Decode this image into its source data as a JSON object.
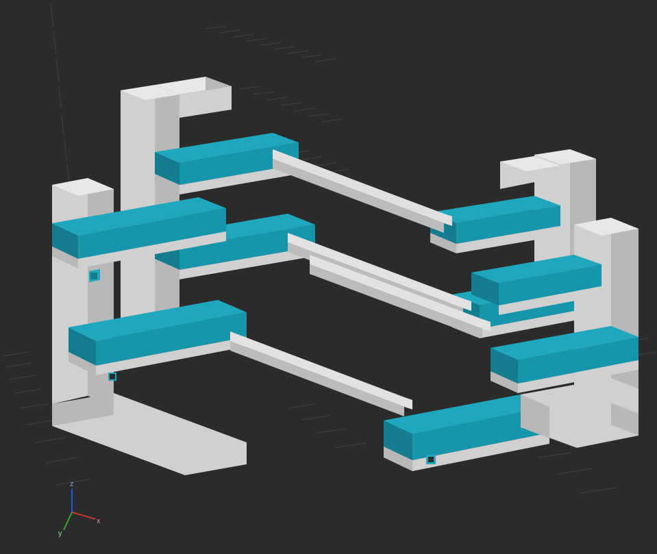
{
  "scene": {
    "background_color": "#2b2b2b",
    "grid_color": "#555555",
    "grid_dark": "#3a3a3a",
    "model": {
      "description": "3D bracket / rack frame with four E-shaped uprights joined by horizontal rods",
      "colors": {
        "top_face": "#e8e8e8",
        "light_face": "#d0d0d0",
        "dark_face": "#b8b8b8",
        "shelf_top": "#1ea7bd",
        "shelf_side_light": "#1795aa",
        "shelf_side_dark": "#137d8f",
        "hole": "#2b2b2b"
      }
    },
    "axis_gizmo": {
      "x": "#cc3333",
      "y": "#33aa33",
      "z": "#3355cc",
      "labels": {
        "x": "x",
        "y": "y",
        "z": "z"
      }
    }
  }
}
